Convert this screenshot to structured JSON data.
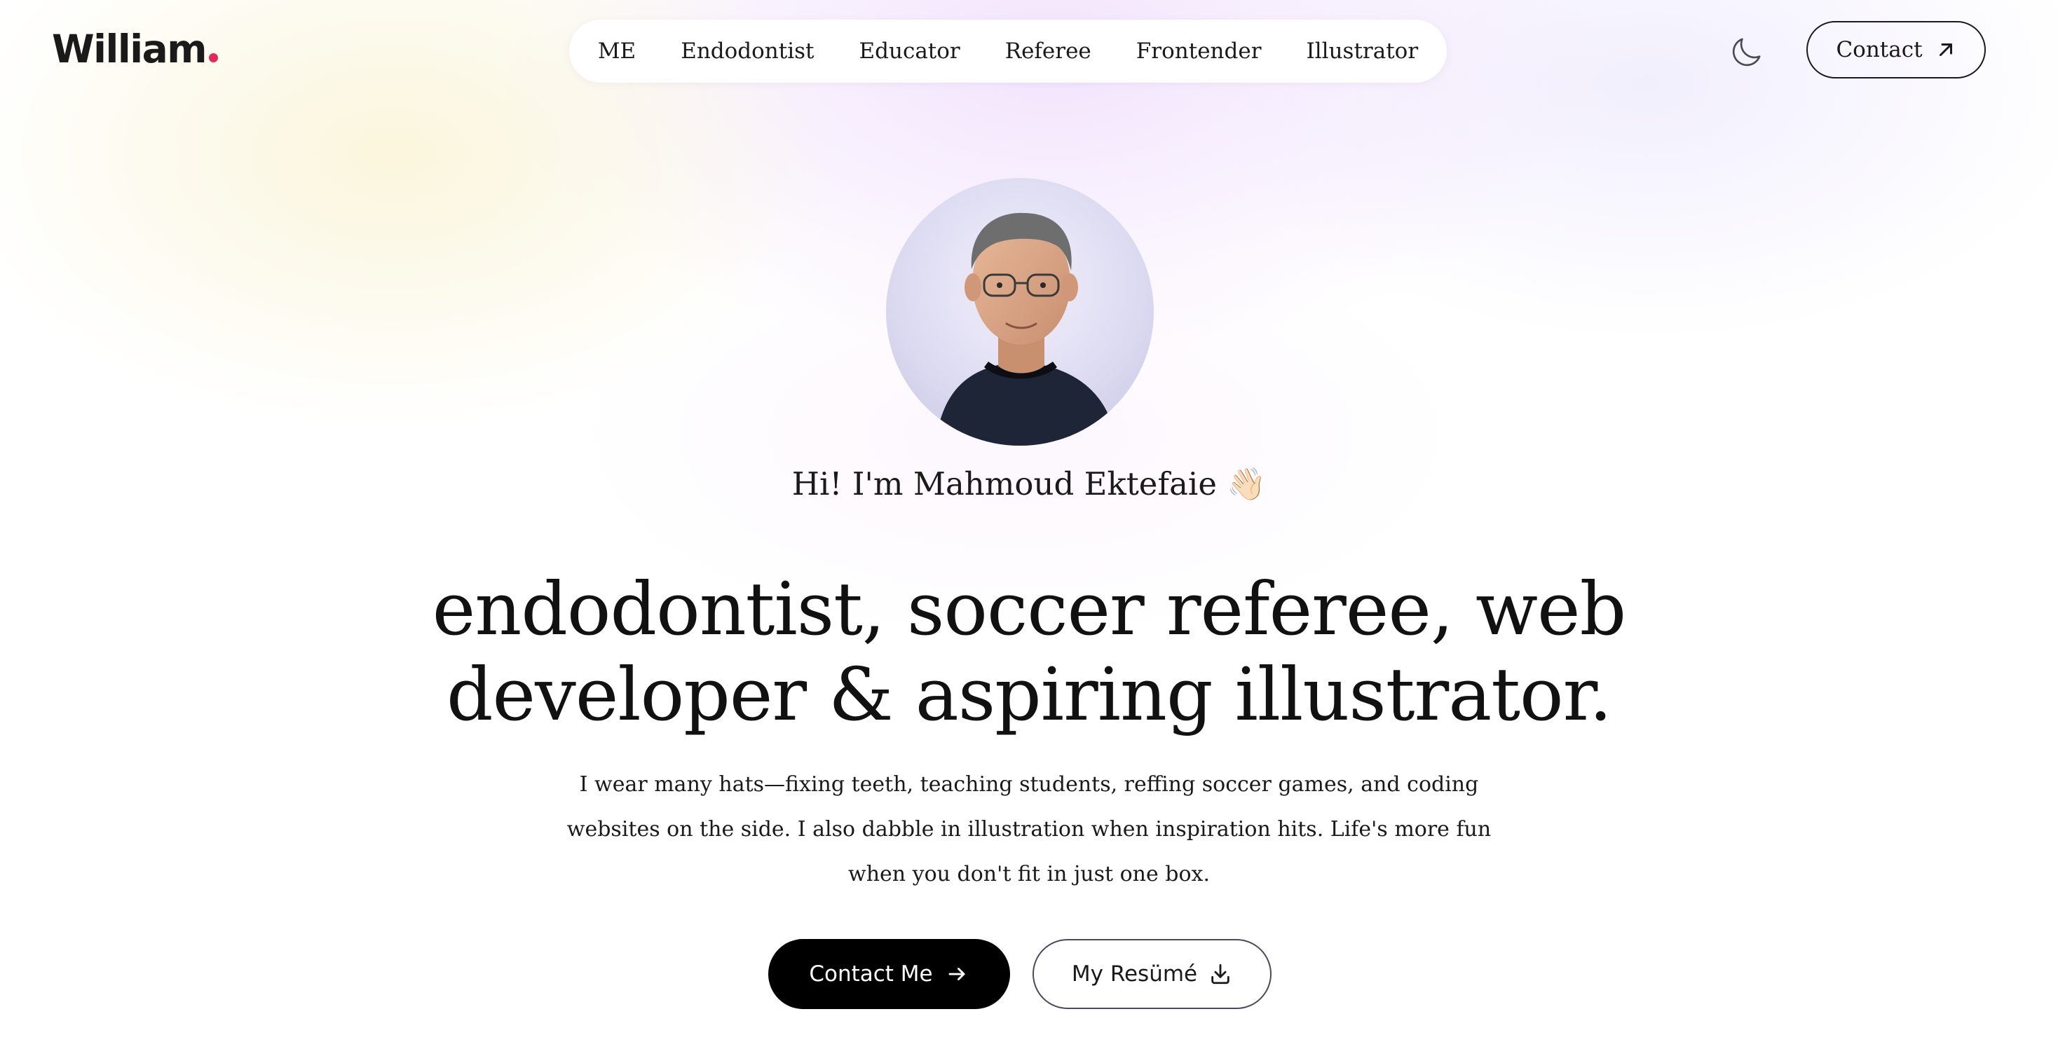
{
  "header": {
    "logo_text": "William",
    "logo_dot_color": "#e3285a",
    "nav_items": [
      {
        "label": "ME"
      },
      {
        "label": "Endodontist"
      },
      {
        "label": "Educator"
      },
      {
        "label": "Referee"
      },
      {
        "label": "Frontender"
      },
      {
        "label": "Illustrator"
      }
    ],
    "theme_toggle_icon": "moon-icon",
    "contact_button": {
      "label": "Contact",
      "icon": "arrow-up-right-icon"
    }
  },
  "hero": {
    "avatar_alt": "profile-photo",
    "greeting": "Hi! I'm Mahmoud Ektefaie 👋🏻",
    "headline": "endodontist, soccer referee, web developer & aspiring illustrator.",
    "description": "I wear many hats—fixing teeth, teaching students, reffing soccer games, and coding websites on the side. I also dabble in illustration when inspiration hits. Life's more fun when you don't fit in just one box.",
    "primary_button": {
      "label": "Contact Me",
      "icon": "arrow-right-icon"
    },
    "secondary_button": {
      "label": "My Resümé",
      "icon": "download-icon"
    }
  },
  "colors": {
    "primary_button_bg": "#000000",
    "text": "#111111",
    "accent": "#e3285a"
  }
}
